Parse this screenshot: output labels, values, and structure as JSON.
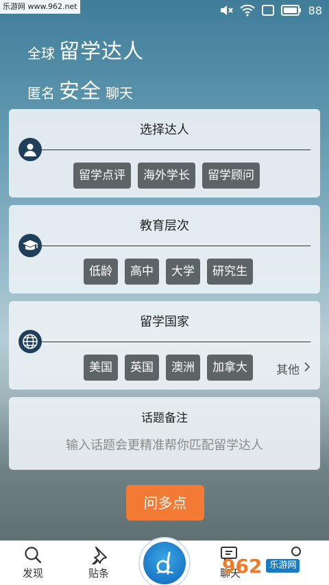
{
  "watermark": "乐游网 www.962.net",
  "status": {
    "battery": "88"
  },
  "hero": {
    "line1_small": "全球",
    "line1_big": "留学达人",
    "line2_small": "匿名",
    "line2_big": "安全",
    "line2_tail": "聊天"
  },
  "cards": {
    "expert": {
      "title": "选择达人",
      "icon": "user-icon",
      "options": [
        "留学点评",
        "海外学长",
        "留学顾问"
      ]
    },
    "education": {
      "title": "教育层次",
      "icon": "graduation-cap-icon",
      "options": [
        "低龄",
        "高中",
        "大学",
        "研究生"
      ]
    },
    "country": {
      "title": "留学国家",
      "icon": "globe-icon",
      "options": [
        "美国",
        "英国",
        "澳洲",
        "加拿大"
      ],
      "other": "其他"
    },
    "note": {
      "title": "话题备注",
      "placeholder": "输入话题会更精准帮你匹配留学达人"
    }
  },
  "ask_button": "问多点",
  "nav": {
    "items": [
      {
        "label": "发现",
        "icon": "search-icon"
      },
      {
        "label": "贴条",
        "icon": "pin-icon"
      },
      {
        "label": "聊天",
        "icon": "chat-icon"
      }
    ],
    "center_icon": "app-logo-icon"
  },
  "corner_logo": {
    "num": "962",
    "txt": "乐游网"
  }
}
